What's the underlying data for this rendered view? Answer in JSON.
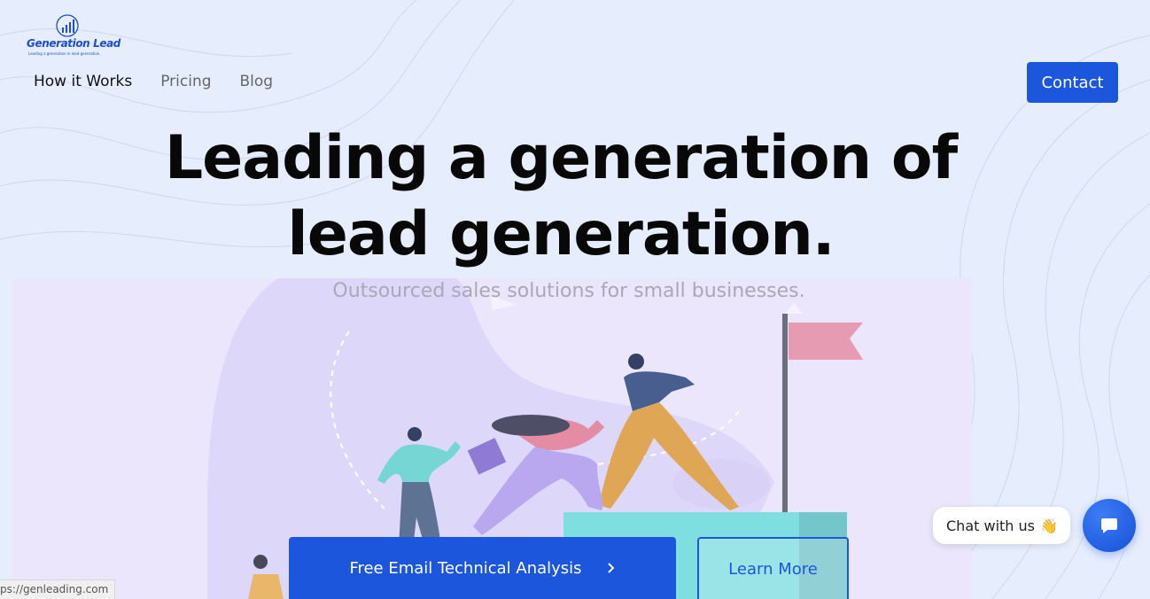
{
  "brand": {
    "name": "Generation Lead",
    "tagline": "Leading a generation in lead generation.",
    "color": "#1c4fd6"
  },
  "nav": {
    "items": [
      {
        "label": "How it Works",
        "active": true
      },
      {
        "label": "Pricing",
        "active": false
      },
      {
        "label": "Blog",
        "active": false
      }
    ],
    "contact_label": "Contact"
  },
  "hero": {
    "title_line1": "Leading a generation of",
    "title_line2": "lead generation.",
    "subtitle": "Outsourced sales solutions for small businesses.",
    "primary_cta": "Free Email Technical Analysis",
    "secondary_cta": "Learn More"
  },
  "chat": {
    "label": "Chat with us",
    "emoji": "👋"
  },
  "status_bar": {
    "url": "ps://genleading.com"
  },
  "colors": {
    "accent": "#1b56dc",
    "background": "#e6edfd"
  },
  "icons": {
    "chevron": "chevron-right-icon",
    "chat": "chat-bubble-icon",
    "logo": "bar-chart-globe-icon"
  }
}
